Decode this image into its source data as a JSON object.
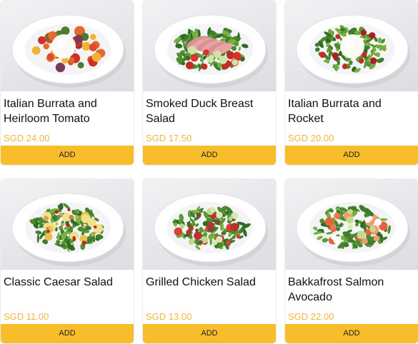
{
  "menu": {
    "items": [
      {
        "name": "Italian Burrata and Heirloom Tomato",
        "price": "SGD 24.00",
        "add_label": "ADD",
        "dish": "burrata-tomato"
      },
      {
        "name": "Smoked Duck Breast Salad",
        "price": "SGD 17.50",
        "add_label": "ADD",
        "dish": "duck"
      },
      {
        "name": "Italian Burrata and Rocket",
        "price": "SGD 20.00",
        "add_label": "ADD",
        "dish": "burrata-rocket"
      },
      {
        "name": "Classic Caesar Salad",
        "price": "SGD 11.00",
        "add_label": "ADD",
        "dish": "caesar"
      },
      {
        "name": "Grilled Chicken Salad",
        "price": "SGD 13.00",
        "add_label": "ADD",
        "dish": "chicken"
      },
      {
        "name": "Bakkafrost Salmon Avocado",
        "price": "SGD 22.00",
        "add_label": "ADD",
        "dish": "salmon"
      }
    ]
  },
  "colors": {
    "price": "#f3b43d",
    "add_button": "#f8bd2b"
  }
}
